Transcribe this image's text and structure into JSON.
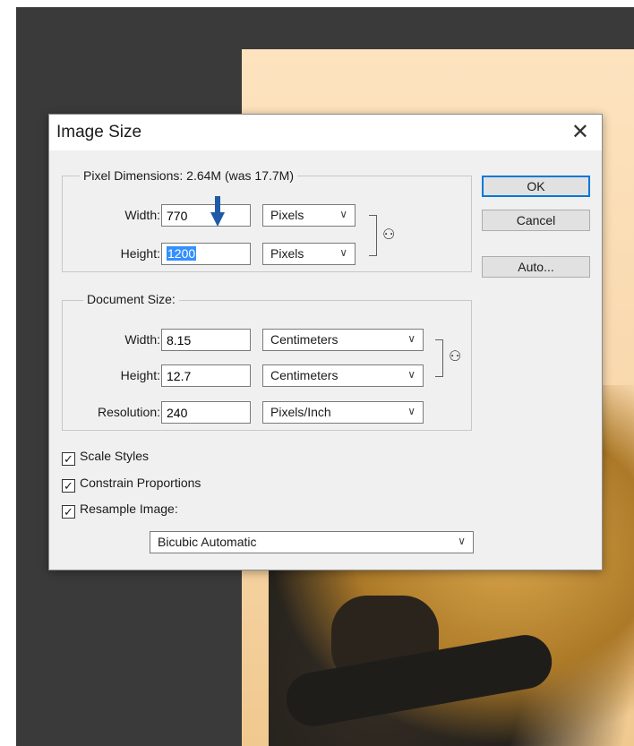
{
  "dialog": {
    "title": "Image Size",
    "close_glyph": "✕"
  },
  "pixel_dimensions": {
    "legend_label": "Pixel Dimensions:",
    "legend_value": "2.64M (was 17.7M)",
    "width_label": "Width:",
    "width_value": "770",
    "width_unit": "Pixels",
    "height_label": "Height:",
    "height_value": "1200",
    "height_unit": "Pixels"
  },
  "document_size": {
    "legend": "Document Size:",
    "width_label": "Width:",
    "width_value": "8.15",
    "width_unit": "Centimeters",
    "height_label": "Height:",
    "height_value": "12.7",
    "height_unit": "Centimeters",
    "resolution_label": "Resolution:",
    "resolution_value": "240",
    "resolution_unit": "Pixels/Inch"
  },
  "buttons": {
    "ok": "OK",
    "cancel": "Cancel",
    "auto": "Auto..."
  },
  "options": {
    "scale_styles": "Scale Styles",
    "constrain_proportions": "Constrain Proportions",
    "resample_image": "Resample Image:",
    "resample_method": "Bicubic Automatic"
  },
  "icons": {
    "dropdown": "chevron-down-icon",
    "link": "chain-link-icon",
    "check": "checkmark-icon",
    "annotation": "arrow-down-icon"
  },
  "colors": {
    "accent": "#0078d7",
    "annotation_arrow": "#1e5aa8",
    "selection": "#3390ff"
  }
}
